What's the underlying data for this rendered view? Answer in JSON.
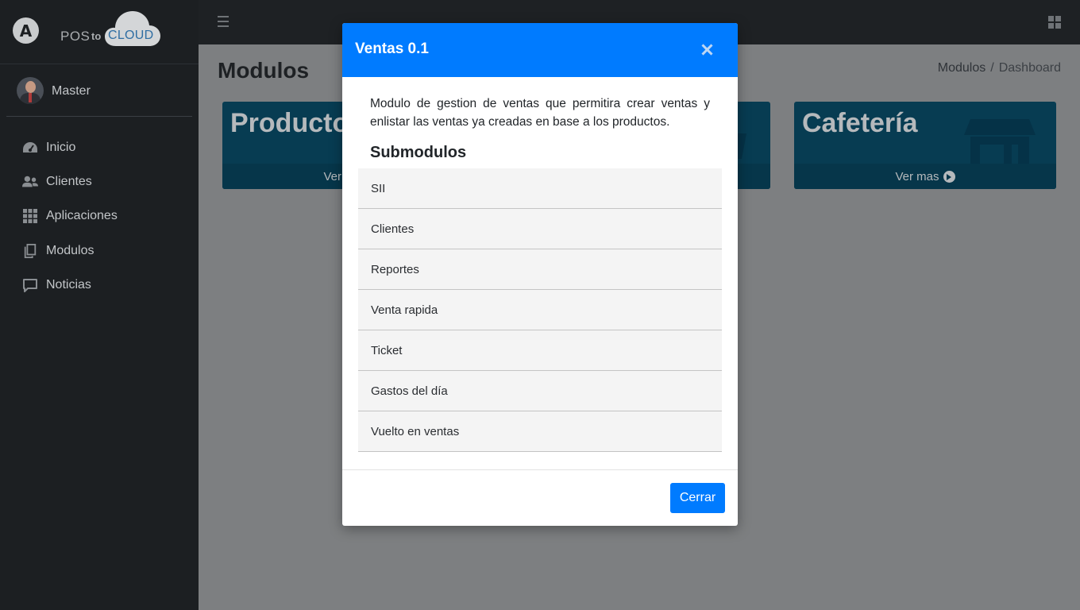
{
  "brand": {
    "logo_letter": "A",
    "pos_label": "POS",
    "to_label": "to",
    "cloud_label": "CLOUD"
  },
  "user": {
    "name": "Master"
  },
  "sidebar": {
    "items": [
      {
        "label": "Inicio",
        "icon": "dashboard-gauge-icon"
      },
      {
        "label": "Clientes",
        "icon": "users-icon"
      },
      {
        "label": "Aplicaciones",
        "icon": "grid-apps-icon"
      },
      {
        "label": "Modulos",
        "icon": "copy-documents-icon"
      },
      {
        "label": "Noticias",
        "icon": "chat-bubble-icon"
      }
    ]
  },
  "page": {
    "title": "Modulos",
    "breadcrumb": {
      "link": "Modulos",
      "separator": "/",
      "current": "Dashboard"
    }
  },
  "cards": [
    {
      "title": "Producto",
      "footer": "Ver mas"
    },
    {
      "title": "",
      "footer": ""
    },
    {
      "title": "Cafetería",
      "footer": "Ver mas"
    }
  ],
  "modal": {
    "title": "Ventas 0.1",
    "description": "Modulo de gestion de ventas que permitira crear ventas y enlistar las ventas ya creadas en base a los productos.",
    "submodules_heading": "Submodulos",
    "submodules": [
      "SII",
      "Clientes",
      "Reportes",
      "Venta rapida",
      "Ticket",
      "Gastos del día",
      "Vuelto en ventas"
    ],
    "close_button": "Cerrar"
  },
  "colors": {
    "primary": "#007bff",
    "sidebar_bg": "#1c1f22",
    "card_bg": "#073c52",
    "overlay": "#7d7f81"
  }
}
